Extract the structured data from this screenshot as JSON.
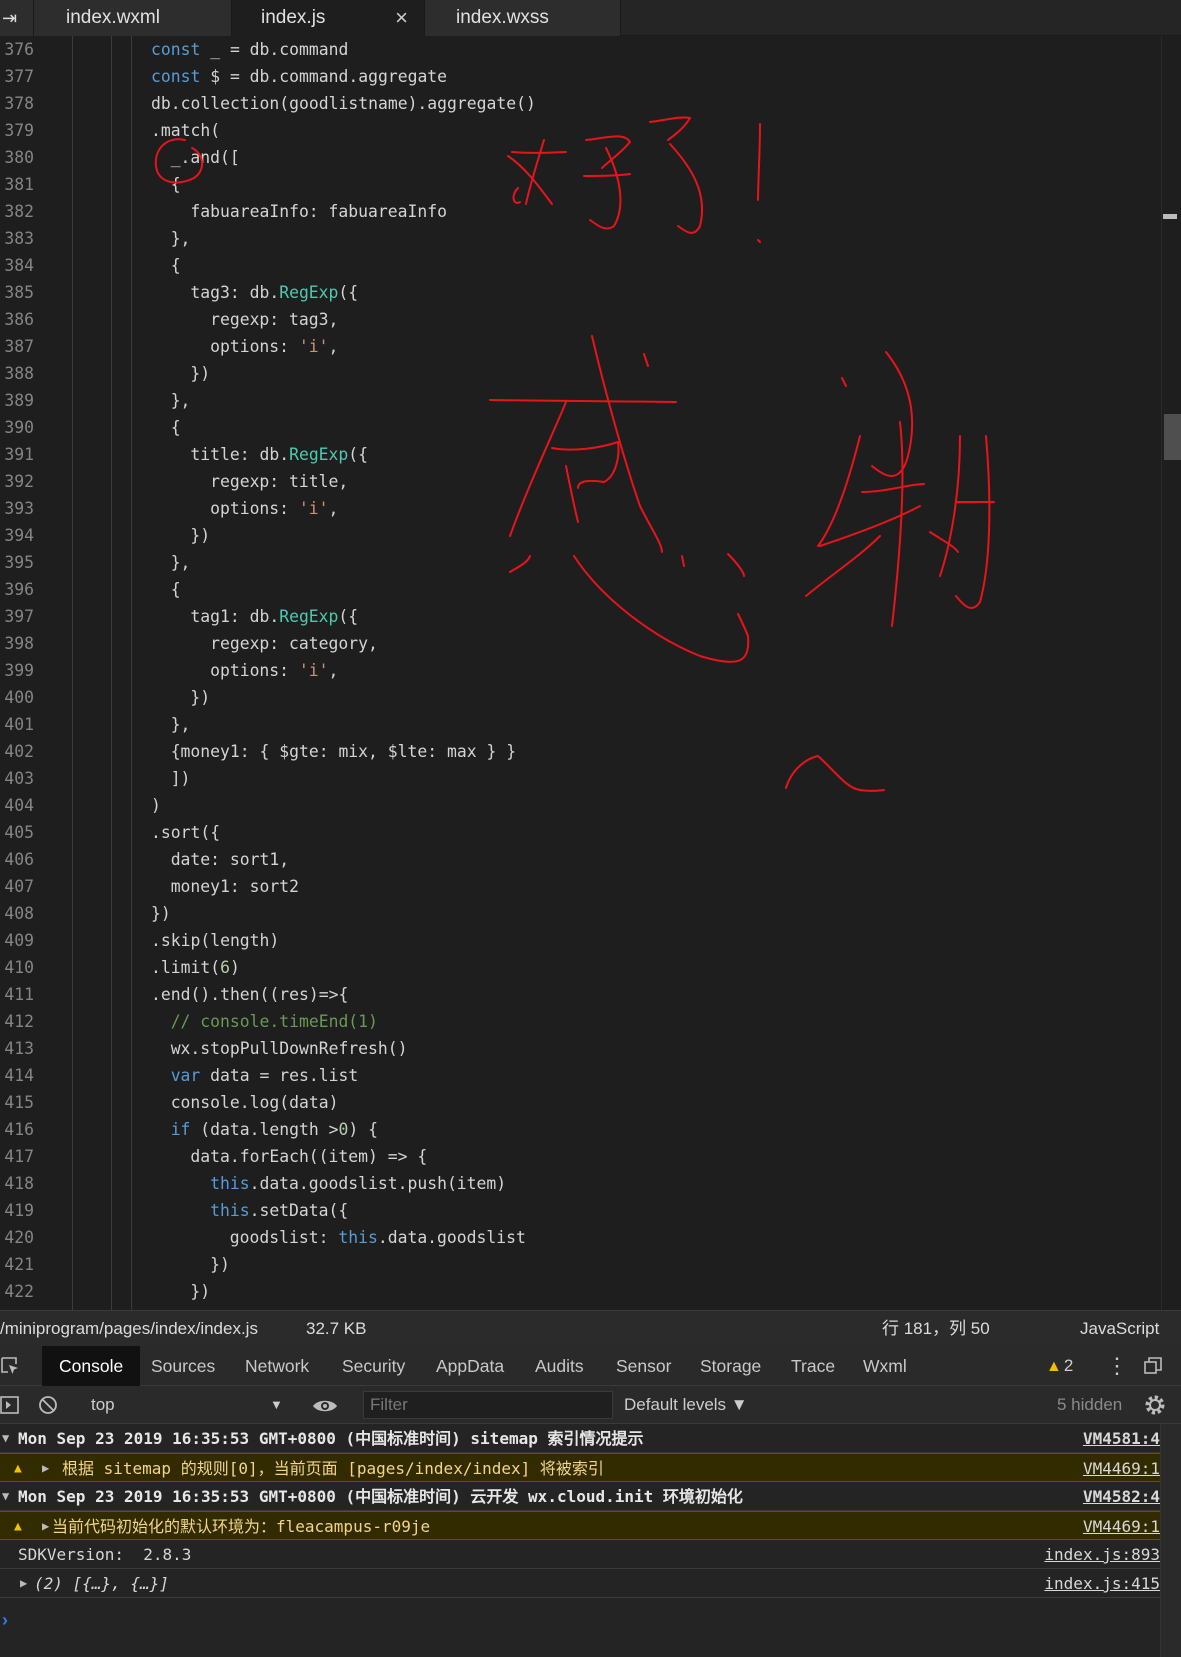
{
  "editor_tabs": [
    {
      "label": "index.wxml",
      "active": false
    },
    {
      "label": "index.js",
      "active": true,
      "close": "×"
    },
    {
      "label": "index.wxss",
      "active": false
    }
  ],
  "tab_edge_glyph": "⇥",
  "code_lines": [
    {
      "n": "376",
      "indent": 0,
      "tokens": [
        {
          "t": "const",
          "c": "kw"
        },
        {
          "t": " _ = db.command"
        }
      ]
    },
    {
      "n": "377",
      "indent": 0,
      "tokens": [
        {
          "t": "const",
          "c": "kw"
        },
        {
          "t": " $ = db.command.aggregate"
        }
      ]
    },
    {
      "n": "378",
      "indent": 0,
      "tokens": [
        {
          "t": "db.collection(goodlistname).aggregate()"
        }
      ]
    },
    {
      "n": "379",
      "indent": 0,
      "tokens": [
        {
          "t": ".match("
        }
      ]
    },
    {
      "n": "380",
      "indent": 1,
      "tokens": [
        {
          "t": "_.and(["
        }
      ]
    },
    {
      "n": "381",
      "indent": 1,
      "tokens": [
        {
          "t": "{"
        }
      ]
    },
    {
      "n": "382",
      "indent": 2,
      "tokens": [
        {
          "t": "fabuareaInfo: fabuareaInfo"
        }
      ]
    },
    {
      "n": "383",
      "indent": 1,
      "tokens": [
        {
          "t": "},"
        }
      ]
    },
    {
      "n": "384",
      "indent": 1,
      "tokens": [
        {
          "t": "{"
        }
      ]
    },
    {
      "n": "385",
      "indent": 2,
      "tokens": [
        {
          "t": "tag3: db."
        },
        {
          "t": "RegExp",
          "c": "cls"
        },
        {
          "t": "({"
        }
      ]
    },
    {
      "n": "386",
      "indent": 3,
      "tokens": [
        {
          "t": "regexp: tag3,"
        }
      ]
    },
    {
      "n": "387",
      "indent": 3,
      "tokens": [
        {
          "t": "options: "
        },
        {
          "t": "'i'",
          "c": "str"
        },
        {
          "t": ","
        }
      ]
    },
    {
      "n": "388",
      "indent": 2,
      "tokens": [
        {
          "t": "})"
        }
      ]
    },
    {
      "n": "389",
      "indent": 1,
      "tokens": [
        {
          "t": "},"
        }
      ]
    },
    {
      "n": "390",
      "indent": 1,
      "tokens": [
        {
          "t": "{"
        }
      ]
    },
    {
      "n": "391",
      "indent": 2,
      "tokens": [
        {
          "t": "title: db."
        },
        {
          "t": "RegExp",
          "c": "cls"
        },
        {
          "t": "({"
        }
      ]
    },
    {
      "n": "392",
      "indent": 3,
      "tokens": [
        {
          "t": "regexp: title,"
        }
      ]
    },
    {
      "n": "393",
      "indent": 3,
      "tokens": [
        {
          "t": "options: "
        },
        {
          "t": "'i'",
          "c": "str"
        },
        {
          "t": ","
        }
      ]
    },
    {
      "n": "394",
      "indent": 2,
      "tokens": [
        {
          "t": "})"
        }
      ]
    },
    {
      "n": "395",
      "indent": 1,
      "tokens": [
        {
          "t": "},"
        }
      ]
    },
    {
      "n": "396",
      "indent": 1,
      "tokens": [
        {
          "t": "{"
        }
      ]
    },
    {
      "n": "397",
      "indent": 2,
      "tokens": [
        {
          "t": "tag1: db."
        },
        {
          "t": "RegExp",
          "c": "cls"
        },
        {
          "t": "({"
        }
      ]
    },
    {
      "n": "398",
      "indent": 3,
      "tokens": [
        {
          "t": "regexp: category,"
        }
      ]
    },
    {
      "n": "399",
      "indent": 3,
      "tokens": [
        {
          "t": "options: "
        },
        {
          "t": "'i'",
          "c": "str"
        },
        {
          "t": ","
        }
      ]
    },
    {
      "n": "400",
      "indent": 2,
      "tokens": [
        {
          "t": "})"
        }
      ]
    },
    {
      "n": "401",
      "indent": 1,
      "tokens": [
        {
          "t": "},"
        }
      ]
    },
    {
      "n": "402",
      "indent": 1,
      "tokens": [
        {
          "t": "{money1: { $gte: mix, $lte: max } }"
        }
      ]
    },
    {
      "n": "403",
      "indent": 1,
      "tokens": [
        {
          "t": "])"
        }
      ]
    },
    {
      "n": "404",
      "indent": 0,
      "tokens": [
        {
          "t": ")"
        }
      ]
    },
    {
      "n": "405",
      "indent": 0,
      "tokens": [
        {
          "t": ".sort({"
        }
      ]
    },
    {
      "n": "406",
      "indent": 1,
      "tokens": [
        {
          "t": "date: sort1,"
        }
      ]
    },
    {
      "n": "407",
      "indent": 1,
      "tokens": [
        {
          "t": "money1: sort2"
        }
      ]
    },
    {
      "n": "408",
      "indent": 0,
      "tokens": [
        {
          "t": "})"
        }
      ]
    },
    {
      "n": "409",
      "indent": 0,
      "tokens": [
        {
          "t": ".skip(length)"
        }
      ]
    },
    {
      "n": "410",
      "indent": 0,
      "tokens": [
        {
          "t": ".limit("
        },
        {
          "t": "6",
          "c": "num"
        },
        {
          "t": ")"
        }
      ]
    },
    {
      "n": "411",
      "indent": 0,
      "tokens": [
        {
          "t": ".end().then((res)=>{"
        }
      ]
    },
    {
      "n": "412",
      "indent": 1,
      "tokens": [
        {
          "t": "// console.timeEnd(1)",
          "c": "cmt"
        }
      ]
    },
    {
      "n": "413",
      "indent": 1,
      "tokens": [
        {
          "t": "wx.stopPullDownRefresh()"
        }
      ]
    },
    {
      "n": "414",
      "indent": 1,
      "tokens": [
        {
          "t": "var",
          "c": "kw"
        },
        {
          "t": " data = res.list"
        }
      ]
    },
    {
      "n": "415",
      "indent": 1,
      "tokens": [
        {
          "t": "console.log(data)"
        }
      ]
    },
    {
      "n": "416",
      "indent": 1,
      "tokens": [
        {
          "t": "if",
          "c": "kw"
        },
        {
          "t": " (data.length >"
        },
        {
          "t": "0",
          "c": "num"
        },
        {
          "t": ") {"
        }
      ]
    },
    {
      "n": "417",
      "indent": 2,
      "tokens": [
        {
          "t": "data.forEach((item) => {"
        }
      ]
    },
    {
      "n": "418",
      "indent": 3,
      "tokens": [
        {
          "t": "this",
          "c": "kw"
        },
        {
          "t": ".data.goodslist.push(item)"
        }
      ]
    },
    {
      "n": "419",
      "indent": 3,
      "tokens": [
        {
          "t": "this",
          "c": "kw"
        },
        {
          "t": ".setData({"
        }
      ]
    },
    {
      "n": "420",
      "indent": 4,
      "tokens": [
        {
          "t": "goodslist: "
        },
        {
          "t": "this",
          "c": "kw"
        },
        {
          "t": ".data.goodslist"
        }
      ]
    },
    {
      "n": "421",
      "indent": 3,
      "tokens": [
        {
          "t": "})"
        }
      ]
    },
    {
      "n": "422",
      "indent": 2,
      "tokens": [
        {
          "t": "})"
        }
      ]
    }
  ],
  "status": {
    "path": "/miniprogram/pages/index/index.js",
    "size": "32.7 KB",
    "cursor": "行 181，列 50",
    "language": "JavaScript"
  },
  "devtools": {
    "tabs": [
      "Console",
      "Sources",
      "Network",
      "Security",
      "AppData",
      "Audits",
      "Sensor",
      "Storage",
      "Trace",
      "Wxml"
    ],
    "active_tab": "Console",
    "warning_count": "2",
    "kebab": "⋮"
  },
  "console_toolbar": {
    "context": "top",
    "filter_placeholder": "Filter",
    "levels": "Default levels ▼",
    "hidden": "5 hidden"
  },
  "console_rows": [
    {
      "kind": "group",
      "text": "Mon Sep 23 2019 16:35:53 GMT+0800 (中国标准时间) sitemap 索引情况提示",
      "src": "VM4581:4"
    },
    {
      "kind": "warn",
      "text": "根据 sitemap 的规则[0]，当前页面 [pages/index/index] 将被索引",
      "src": "VM4469:1"
    },
    {
      "kind": "group",
      "text": "Mon Sep 23 2019 16:35:53 GMT+0800 (中国标准时间) 云开发 wx.cloud.init 环境初始化",
      "src": "VM4582:4"
    },
    {
      "kind": "warn",
      "text": "当前代码初始化的默认环境为：fleacampus-r09je",
      "src": "VM4469:1"
    },
    {
      "kind": "log",
      "text": "SDKVersion:  2.8.3",
      "src": "index.js:893"
    },
    {
      "kind": "log",
      "text": "(2) [{…}, {…}]",
      "src": "index.js:415"
    }
  ],
  "colors": {
    "editor_bg": "#1e1e1e",
    "annotation_red": "#e8141c",
    "warn_bg": "#332b00"
  }
}
